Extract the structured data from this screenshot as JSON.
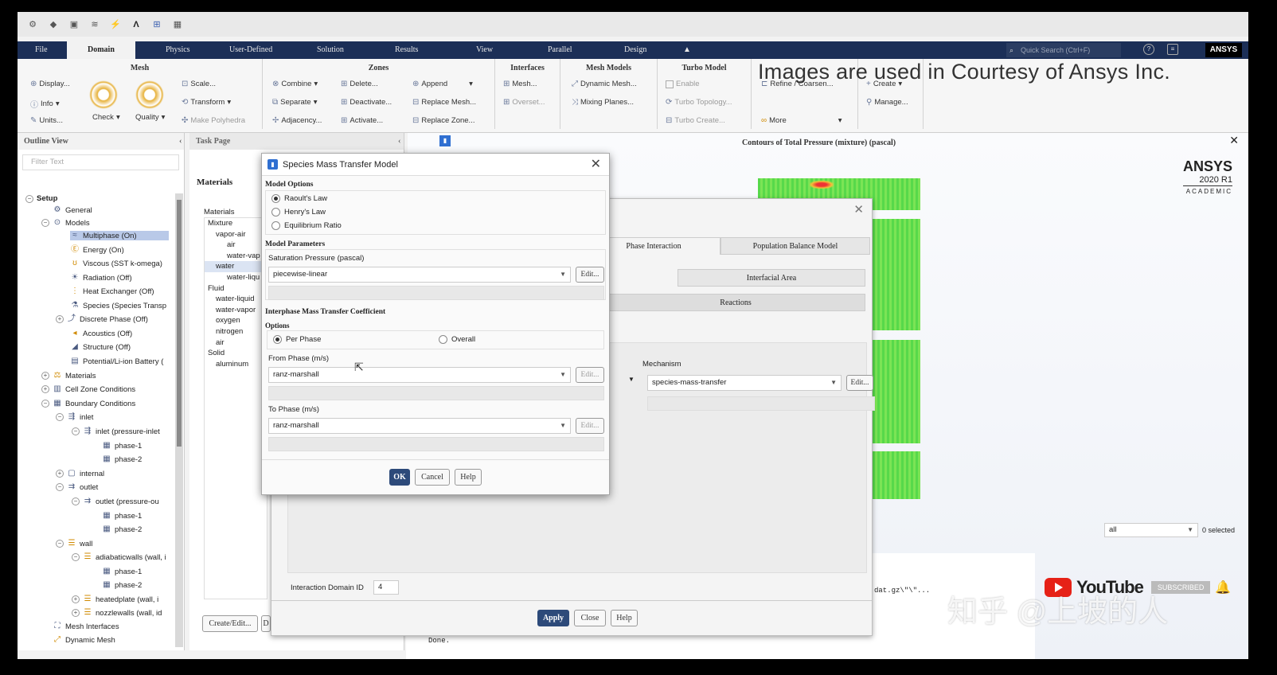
{
  "tabs": [
    "File",
    "Domain",
    "Physics",
    "User-Defined",
    "Solution",
    "Results",
    "View",
    "Parallel",
    "Design"
  ],
  "quick_search_placeholder": "Quick Search (Ctrl+F)",
  "brand": "ANSYS",
  "ribbon": {
    "mesh": {
      "title": "Mesh",
      "display": "Display...",
      "info": "Info",
      "units": "Units...",
      "check": "Check",
      "quality": "Quality",
      "scale": "Scale...",
      "transform": "Transform",
      "make_polyhedra": "Make Polyhedra"
    },
    "zones": {
      "title": "Zones",
      "combine": "Combine",
      "separate": "Separate",
      "adjacency": "Adjacency...",
      "delete": "Delete...",
      "deactivate": "Deactivate...",
      "activate": "Activate...",
      "append": "Append",
      "replace_mesh": "Replace Mesh...",
      "replace_zone": "Replace Zone..."
    },
    "interfaces": {
      "title": "Interfaces",
      "mesh": "Mesh...",
      "overset": "Overset..."
    },
    "mesh_models": {
      "title": "Mesh Models",
      "dynamic_mesh": "Dynamic Mesh...",
      "mixing_planes": "Mixing Planes..."
    },
    "turbo_model": {
      "title": "Turbo Model",
      "enable": "Enable",
      "turbo_topology": "Turbo Topology...",
      "turbo_create": "Turbo Create..."
    },
    "adapt": {
      "refine": "Refine / Coarsen...",
      "more": "More"
    },
    "surface": {
      "create": "Create",
      "manage": "Manage..."
    }
  },
  "courtesy_text": "Images are used in Courtesy of Ansys Inc.",
  "outline": {
    "title": "Outline View",
    "filter_placeholder": "Filter Text",
    "items": [
      "Setup",
      "General",
      "Models",
      "Multiphase (On)",
      "Energy (On)",
      "Viscous (SST k-omega)",
      "Radiation (Off)",
      "Heat Exchanger (Off)",
      "Species (Species Transp",
      "Discrete Phase (Off)",
      "Acoustics (Off)",
      "Structure (Off)",
      "Potential/Li-ion Battery (",
      "Materials",
      "Cell Zone Conditions",
      "Boundary Conditions",
      "inlet",
      "inlet (pressure-inlet",
      "phase-1",
      "phase-2",
      "internal",
      "outlet",
      "outlet (pressure-ou",
      "phase-1",
      "phase-2",
      "wall",
      "adiabaticwalls (wall, i",
      "phase-1",
      "phase-2",
      "heatedplate (wall, i",
      "nozzlewalls (wall, id",
      "Mesh Interfaces",
      "Dynamic Mesh"
    ]
  },
  "task_page": {
    "title": "Task Page",
    "heading": "Materials",
    "list_label": "Materials",
    "list": [
      "Mixture",
      "vapor-air",
      "air",
      "water-vap",
      "water",
      "water-liqu",
      "Fluid",
      "water-liquid",
      "water-vapor",
      "oxygen",
      "nitrogen",
      "air",
      "Solid",
      "aluminum"
    ],
    "create_edit": "Create/Edit...",
    "d": "D"
  },
  "graphics": {
    "title": "Contours of Total Pressure (mixture)  (pascal)",
    "ansys": "ANSYS",
    "version": "2020 R1",
    "academic": "ACADEMIC",
    "filter_value": "all",
    "selected": "0 selected"
  },
  "multiphase_dialog": {
    "tabs": [
      "Phase Interaction",
      "Population Balance Model"
    ],
    "subtabs": [
      "Interfacial Area",
      "Reactions"
    ],
    "mechanism_label": "Mechanism",
    "mechanism_value": "species-mass-transfer",
    "edit": "Edit...",
    "interaction_domain_label": "Interaction Domain ID",
    "interaction_domain_value": "4",
    "apply": "Apply",
    "close": "Close",
    "help": "Help"
  },
  "species_dialog": {
    "title": "Species Mass Transfer Model",
    "model_options": "Model Options",
    "options": [
      "Raoult's Law",
      "Henry's Law",
      "Equilibrium Ratio"
    ],
    "model_parameters": "Model Parameters",
    "saturation_label": "Saturation Pressure (pascal)",
    "saturation_value": "piecewise-linear",
    "interphase_title": "Interphase Mass Transfer Coefficient",
    "options_label": "Options",
    "per_phase": "Per Phase",
    "overall": "Overall",
    "from_phase_label": "From Phase (m/s)",
    "from_phase_value": "ranz-marshall",
    "to_phase_label": "To Phase (m/s)",
    "to_phase_value": "ranz-marshall",
    "edit": "Edit...",
    "ok": "OK",
    "cancel": "Cancel",
    "help": "Help"
  },
  "console": {
    "line1": "dat.gz\\\"\\\"...",
    "done": "Done."
  },
  "youtube": {
    "name": "YouTube",
    "subscribed": "SUBSCRIBED"
  },
  "watermark": "知乎 @上坡的人"
}
